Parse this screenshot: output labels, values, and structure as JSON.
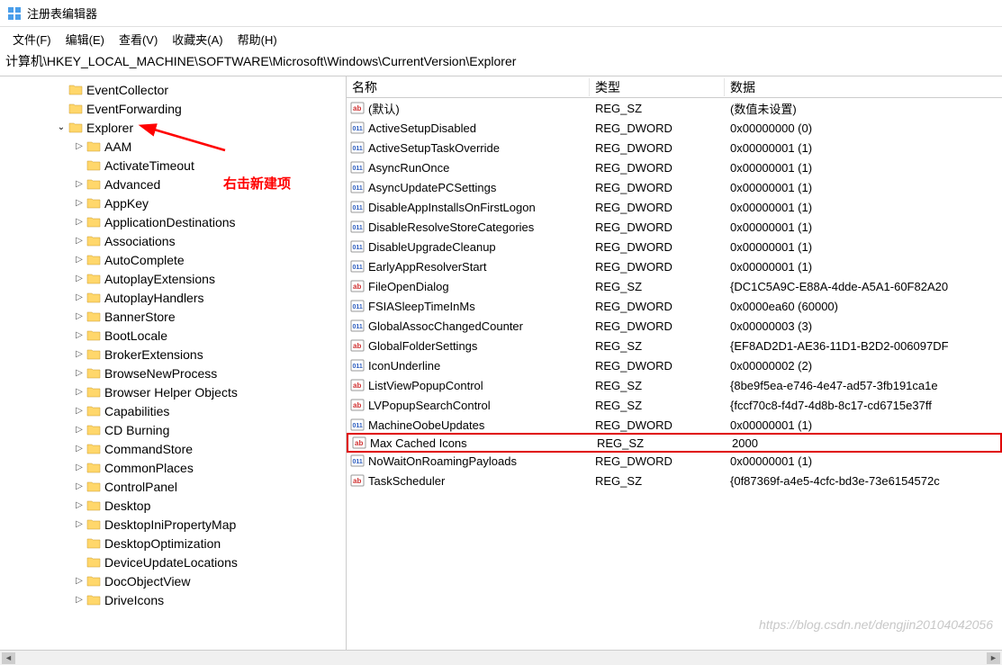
{
  "window": {
    "title": "注册表编辑器"
  },
  "menu": [
    {
      "label": "文件(F)"
    },
    {
      "label": "编辑(E)"
    },
    {
      "label": "查看(V)"
    },
    {
      "label": "收藏夹(A)"
    },
    {
      "label": "帮助(H)"
    }
  ],
  "address": "计算机\\HKEY_LOCAL_MACHINE\\SOFTWARE\\Microsoft\\Windows\\CurrentVersion\\Explorer",
  "tree": [
    {
      "indent": 60,
      "exp": "",
      "label": "EventCollector"
    },
    {
      "indent": 60,
      "exp": "",
      "label": "EventForwarding"
    },
    {
      "indent": 60,
      "exp": "v",
      "label": "Explorer",
      "selected": true
    },
    {
      "indent": 80,
      "exp": ">",
      "label": "AAM"
    },
    {
      "indent": 80,
      "exp": "",
      "label": "ActivateTimeout"
    },
    {
      "indent": 80,
      "exp": ">",
      "label": "Advanced"
    },
    {
      "indent": 80,
      "exp": ">",
      "label": "AppKey"
    },
    {
      "indent": 80,
      "exp": ">",
      "label": "ApplicationDestinations"
    },
    {
      "indent": 80,
      "exp": ">",
      "label": "Associations"
    },
    {
      "indent": 80,
      "exp": ">",
      "label": "AutoComplete"
    },
    {
      "indent": 80,
      "exp": ">",
      "label": "AutoplayExtensions"
    },
    {
      "indent": 80,
      "exp": ">",
      "label": "AutoplayHandlers"
    },
    {
      "indent": 80,
      "exp": ">",
      "label": "BannerStore"
    },
    {
      "indent": 80,
      "exp": ">",
      "label": "BootLocale"
    },
    {
      "indent": 80,
      "exp": ">",
      "label": "BrokerExtensions"
    },
    {
      "indent": 80,
      "exp": ">",
      "label": "BrowseNewProcess"
    },
    {
      "indent": 80,
      "exp": ">",
      "label": "Browser Helper Objects"
    },
    {
      "indent": 80,
      "exp": ">",
      "label": "Capabilities"
    },
    {
      "indent": 80,
      "exp": ">",
      "label": "CD Burning"
    },
    {
      "indent": 80,
      "exp": ">",
      "label": "CommandStore"
    },
    {
      "indent": 80,
      "exp": ">",
      "label": "CommonPlaces"
    },
    {
      "indent": 80,
      "exp": ">",
      "label": "ControlPanel"
    },
    {
      "indent": 80,
      "exp": ">",
      "label": "Desktop"
    },
    {
      "indent": 80,
      "exp": ">",
      "label": "DesktopIniPropertyMap"
    },
    {
      "indent": 80,
      "exp": "",
      "label": "DesktopOptimization"
    },
    {
      "indent": 80,
      "exp": "",
      "label": "DeviceUpdateLocations"
    },
    {
      "indent": 80,
      "exp": ">",
      "label": "DocObjectView"
    },
    {
      "indent": 80,
      "exp": ">",
      "label": "DriveIcons"
    }
  ],
  "columns": {
    "name": "名称",
    "type": "类型",
    "data": "数据"
  },
  "values": [
    {
      "icon": "sz",
      "name": "(默认)",
      "type": "REG_SZ",
      "data": "(数值未设置)"
    },
    {
      "icon": "dw",
      "name": "ActiveSetupDisabled",
      "type": "REG_DWORD",
      "data": "0x00000000 (0)"
    },
    {
      "icon": "dw",
      "name": "ActiveSetupTaskOverride",
      "type": "REG_DWORD",
      "data": "0x00000001 (1)"
    },
    {
      "icon": "dw",
      "name": "AsyncRunOnce",
      "type": "REG_DWORD",
      "data": "0x00000001 (1)"
    },
    {
      "icon": "dw",
      "name": "AsyncUpdatePCSettings",
      "type": "REG_DWORD",
      "data": "0x00000001 (1)"
    },
    {
      "icon": "dw",
      "name": "DisableAppInstallsOnFirstLogon",
      "type": "REG_DWORD",
      "data": "0x00000001 (1)"
    },
    {
      "icon": "dw",
      "name": "DisableResolveStoreCategories",
      "type": "REG_DWORD",
      "data": "0x00000001 (1)"
    },
    {
      "icon": "dw",
      "name": "DisableUpgradeCleanup",
      "type": "REG_DWORD",
      "data": "0x00000001 (1)"
    },
    {
      "icon": "dw",
      "name": "EarlyAppResolverStart",
      "type": "REG_DWORD",
      "data": "0x00000001 (1)"
    },
    {
      "icon": "sz",
      "name": "FileOpenDialog",
      "type": "REG_SZ",
      "data": "{DC1C5A9C-E88A-4dde-A5A1-60F82A20"
    },
    {
      "icon": "dw",
      "name": "FSIASleepTimeInMs",
      "type": "REG_DWORD",
      "data": "0x0000ea60 (60000)"
    },
    {
      "icon": "dw",
      "name": "GlobalAssocChangedCounter",
      "type": "REG_DWORD",
      "data": "0x00000003 (3)"
    },
    {
      "icon": "sz",
      "name": "GlobalFolderSettings",
      "type": "REG_SZ",
      "data": "{EF8AD2D1-AE36-11D1-B2D2-006097DF"
    },
    {
      "icon": "dw",
      "name": "IconUnderline",
      "type": "REG_DWORD",
      "data": "0x00000002 (2)"
    },
    {
      "icon": "sz",
      "name": "ListViewPopupControl",
      "type": "REG_SZ",
      "data": "{8be9f5ea-e746-4e47-ad57-3fb191ca1e"
    },
    {
      "icon": "sz",
      "name": "LVPopupSearchControl",
      "type": "REG_SZ",
      "data": "{fccf70c8-f4d7-4d8b-8c17-cd6715e37ff"
    },
    {
      "icon": "dw",
      "name": "MachineOobeUpdates",
      "type": "REG_DWORD",
      "data": "0x00000001 (1)"
    },
    {
      "icon": "sz",
      "name": "Max Cached Icons",
      "type": "REG_SZ",
      "data": "2000",
      "highlight": true
    },
    {
      "icon": "dw",
      "name": "NoWaitOnRoamingPayloads",
      "type": "REG_DWORD",
      "data": "0x00000001 (1)"
    },
    {
      "icon": "sz",
      "name": "TaskScheduler",
      "type": "REG_SZ",
      "data": "{0f87369f-a4e5-4cfc-bd3e-73e6154572c"
    }
  ],
  "annotation": "右击新建项",
  "watermark": "https://blog.csdn.net/dengjin20104042056"
}
